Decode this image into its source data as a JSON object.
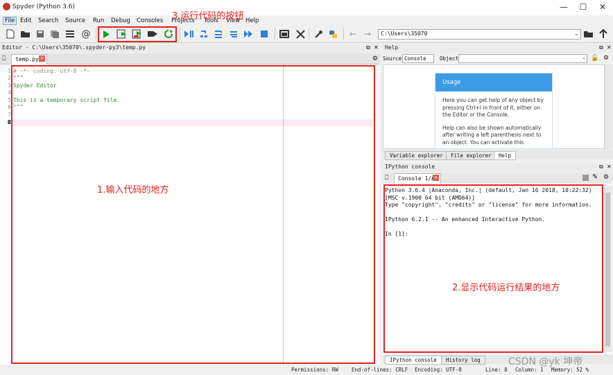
{
  "window": {
    "title": "Spyder (Python 3.6)",
    "controls": [
      "minimize-icon",
      "maximize-icon",
      "close-icon"
    ]
  },
  "menubar": {
    "items": [
      "File",
      "Edit",
      "Search",
      "Source",
      "Run",
      "Debug",
      "Consoles",
      "Projects",
      "Tools",
      "View",
      "Help"
    ]
  },
  "toolbar": {
    "path_value": "C:\\Users\\35070",
    "annotation": "3.运行代码的按钮"
  },
  "editor": {
    "pane_title": "Editor - C:\\Users\\35070\\.spyder-py3\\temp.py",
    "tab_label": "temp.py",
    "code_lines": [
      "# -*- coding: utf-8 -*-",
      "\"\"\"",
      "Spyder Editor",
      "",
      "This is a temporary script file.",
      "\"\"\"",
      "",
      ""
    ],
    "line_numbers": [
      "1",
      "2",
      "3",
      "4",
      "5",
      "6",
      "7",
      "8"
    ],
    "annotation": "1.输入代码的地方"
  },
  "help": {
    "pane_title": "Help",
    "source_label": "Source",
    "source_value": "Console",
    "object_label": "Object",
    "usage_title": "Usage",
    "usage_p1": "Here you can get help of any object by pressing Ctrl+I in front of it, either on the Editor or the Console.",
    "usage_p2": "Help can also be shown automatically after writing a left parenthesis next to an object. You can activate this",
    "tabs": [
      "Variable explorer",
      "File explorer",
      "Help"
    ]
  },
  "console": {
    "pane_title": "IPython console",
    "tab_label": "Console 1/A",
    "lines": [
      "Python 3.6.4 |Anaconda, Inc.| (default, Jan 16 2018, 10:22:32)",
      "[MSC v.1900 64 bit (AMD64)]",
      "Type \"copyright\", \"credits\" or \"license\" for more information.",
      "",
      "IPython 6.2.1 -- An enhanced Interactive Python.",
      "",
      "In [1]:"
    ],
    "bottom_tabs": [
      "IPython console",
      "History log"
    ],
    "annotation": "2.显示代码运行结果的地方"
  },
  "statusbar": {
    "permissions": "Permissions: RW",
    "eol": "End-of-lines: CRLF",
    "encoding": "Encoding: UTF-8",
    "line": "Line: 8",
    "column": "Column: 1",
    "memory": "Memory: 52 %"
  },
  "watermark": "CSDN @yk 坤帝",
  "colors": {
    "annotation_red": "#e0231e",
    "help_header_blue": "#3b9be5",
    "run_green": "#1a9a1a",
    "debug_blue": "#2f7ed8"
  }
}
